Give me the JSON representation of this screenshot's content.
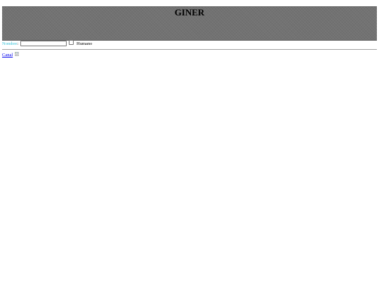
{
  "header": {
    "title": "GINER"
  },
  "form": {
    "name_label": "Nombre",
    "colon": ":",
    "name_value": "",
    "human_checkbox_checked": false,
    "human_label": "Humano"
  },
  "links": {
    "canal_label": "Canal",
    "canal_image": "broken-image-icon"
  },
  "colors": {
    "header_bg": "#737373",
    "name_label": "#36c2d8",
    "link": "#0000ee"
  }
}
